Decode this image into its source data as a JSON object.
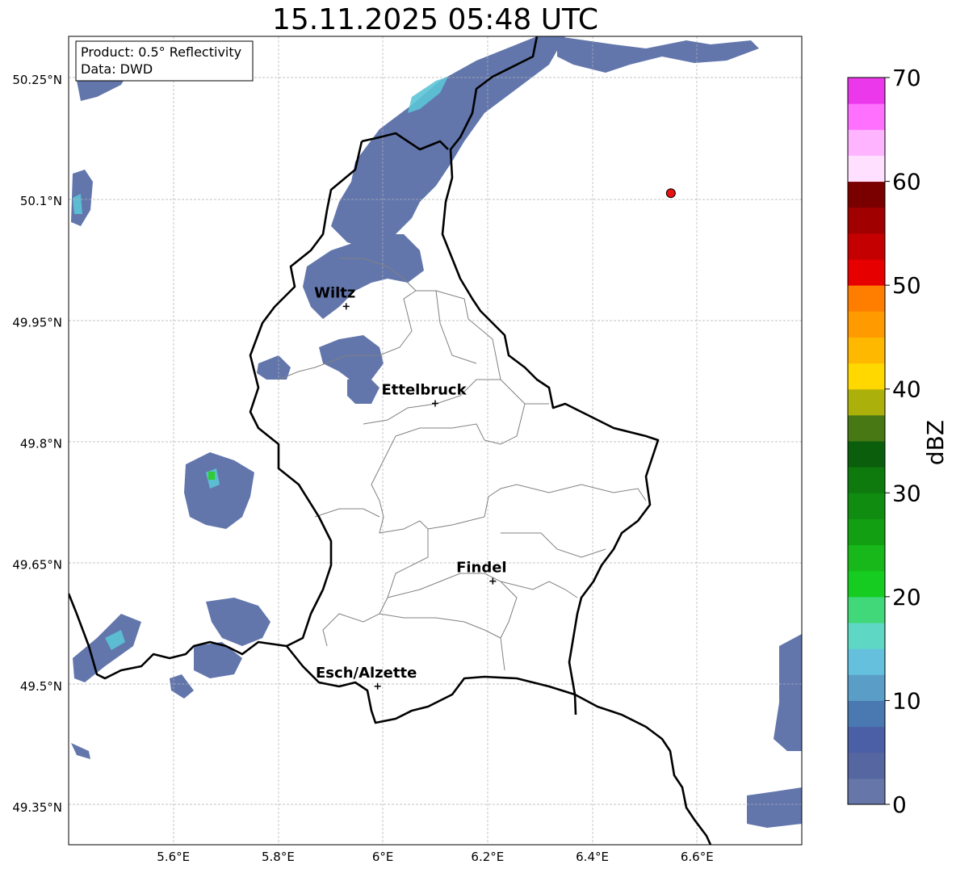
{
  "title": "15.11.2025 05:48 UTC",
  "info": {
    "product": "Product: 0.5° Reflectivity",
    "data": "Data: DWD"
  },
  "map": {
    "extent": {
      "lon_min": 5.4,
      "lon_max": 6.8,
      "lat_min": 49.3,
      "lat_max": 50.3
    },
    "lon_ticks": [
      5.6,
      5.8,
      6.0,
      6.2,
      6.4,
      6.6
    ],
    "lon_labels": [
      "5.6°E",
      "5.8°E",
      "6°E",
      "6.2°E",
      "6.4°E",
      "6.6°E"
    ],
    "lat_ticks": [
      50.25,
      50.1,
      49.95,
      49.8,
      49.65,
      49.5,
      49.35
    ],
    "lat_labels": [
      "50.25°N",
      "50.1°N",
      "49.95°N",
      "49.8°N",
      "49.65°N",
      "49.5°N",
      "49.35°N"
    ],
    "cities": [
      {
        "name": "Wiltz",
        "lon": 5.93,
        "lat": 49.97
      },
      {
        "name": "Ettelbruck",
        "lon": 6.1,
        "lat": 49.85
      },
      {
        "name": "Findel",
        "lon": 6.21,
        "lat": 49.63
      },
      {
        "name": "Esch/Alzette",
        "lon": 5.99,
        "lat": 49.5
      }
    ],
    "radar_site": {
      "lon": 6.55,
      "lat": 50.11,
      "color": "#e81010"
    }
  },
  "colorbar": {
    "label": "dBZ",
    "min": 0,
    "max": 70,
    "step": 2.5,
    "ticks": [
      0,
      10,
      20,
      30,
      40,
      50,
      60,
      70
    ],
    "colors": [
      "#6676a8",
      "#5566a0",
      "#4a5fa6",
      "#4a78b0",
      "#5a9ec8",
      "#64c0dc",
      "#5ed8c4",
      "#40d878",
      "#16cc20",
      "#18b81a",
      "#12a012",
      "#108c10",
      "#0e7a0e",
      "#0b5e0b",
      "#487814",
      "#acb00a",
      "#ffd800",
      "#ffb800",
      "#ff9a00",
      "#ff7e00",
      "#e60000",
      "#c40000",
      "#a00000",
      "#7a0000",
      "#ffe0ff",
      "#ffb4ff",
      "#ff70ff",
      "#ea38ea"
    ]
  }
}
